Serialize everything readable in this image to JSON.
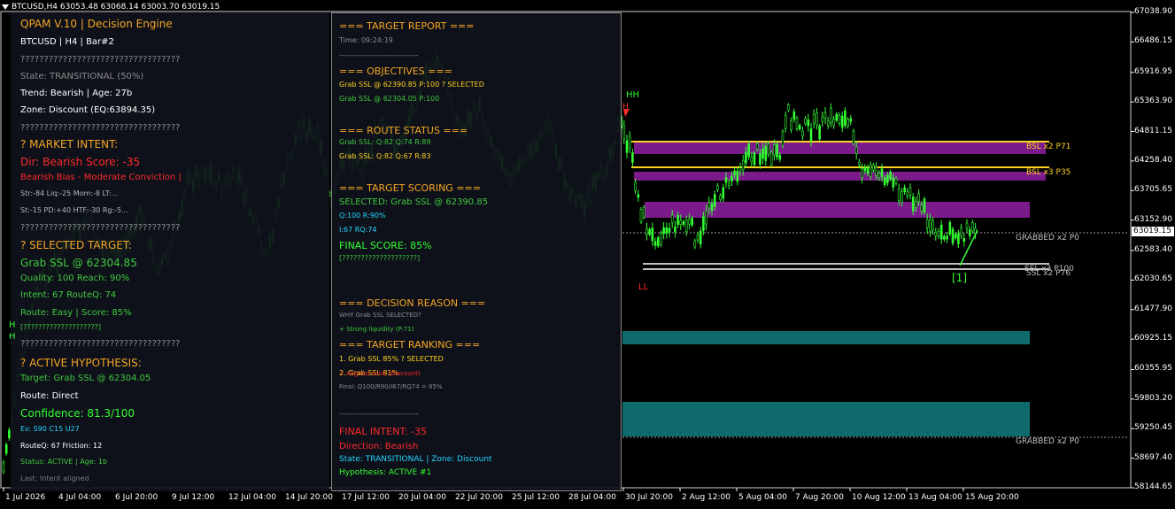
{
  "window": {
    "title": "BTCUSD,H4  63053.48 63068.14 63003.70 63019.15"
  },
  "chart_data": {
    "type": "candlestick",
    "symbol": "BTCUSD",
    "timeframe": "H4",
    "x_labels": [
      "1 Jul 2026",
      "4 Jul 04:00",
      "6 Jul 20:00",
      "9 Jul 12:00",
      "12 Jul 04:00",
      "14 Jul 20:00",
      "17 Jul 12:00",
      "20 Jul 04:00",
      "22 Jul 20:00",
      "25 Jul 12:00",
      "28 Jul 04:00",
      "30 Jul 20:00",
      "2 Aug 12:00",
      "5 Aug 04:00",
      "7 Aug 20:00",
      "10 Aug 12:00",
      "13 Aug 04:00",
      "15 Aug 20:00"
    ],
    "y_labels": [
      "67038.90",
      "66486.15",
      "65916.95",
      "65363.90",
      "64811.15",
      "64258.40",
      "63705.65",
      "63152.90",
      "62583.40",
      "62030.65",
      "61477.90",
      "60925.15",
      "60355.95",
      "59803.20",
      "59250.45",
      "58697.40",
      "58144.65"
    ],
    "current_price": "63019.15",
    "ylim": [
      58144.65,
      67038.9
    ],
    "zones": [
      {
        "label": "BSL x2 P71",
        "price": 64700,
        "color": "#ffd21e"
      },
      {
        "label": "BSL x3 P35",
        "price": 64160,
        "color": "#ffd21e"
      },
      {
        "label": "GRABBED x2 P0",
        "price": 62960,
        "color": "#bfbfbf"
      },
      {
        "label": "SSL x3 P100",
        "price": 62360,
        "color": "#bfbfbf"
      },
      {
        "label": "SSL x2 P76",
        "price": 62300,
        "color": "#bfbfbf"
      },
      {
        "label": "GRABBED x2 P0",
        "price": 59180,
        "color": "#bfbfbf"
      }
    ],
    "markers": [
      {
        "label": "HH",
        "color": "#33ff33"
      },
      {
        "label": "H",
        "color": "#ff2a2a"
      },
      {
        "label": "LL",
        "color": "#ff2a2a"
      },
      {
        "label": "[1]",
        "color": "#33ff33"
      },
      {
        "label": "H",
        "color": "#33ff33"
      },
      {
        "label": "H",
        "color": "#33ff33"
      }
    ],
    "colors": {
      "bull": "#33ff33",
      "bear": "#33ff33",
      "bsl": "#ffd21e",
      "purple": "#7b1a8a",
      "teal": "#0f6b6b"
    }
  },
  "left_panel": {
    "lines": [
      {
        "text": "QPAM V.10 | Decision Engine",
        "cls": "c-orange",
        "size": 12
      },
      {
        "text": "BTCUSD | H4 | Bar#2",
        "cls": "c-white",
        "size": 10
      },
      {
        "text": "??????????????????????????????????",
        "cls": "c-gray",
        "size": 10
      },
      {
        "text": "State: TRANSITIONAL (50%)",
        "cls": "c-gray",
        "size": 10
      },
      {
        "text": "Trend: Bearish | Age: 27b",
        "cls": "c-white",
        "size": 10
      },
      {
        "text": "Zone: Discount (EQ:63894.35)",
        "cls": "c-white",
        "size": 10
      },
      {
        "text": "??????????????????????????????????",
        "cls": "c-gray",
        "size": 10
      },
      {
        "text": "? MARKET INTENT:",
        "cls": "c-orange",
        "size": 12
      },
      {
        "text": "Dir: Bearish  Score: -35",
        "cls": "c-red",
        "size": 12
      },
      {
        "text": "Bearish Bias - Moderate Conviction |",
        "cls": "c-red",
        "size": 10
      },
      {
        "text": "Str:-84 Liq:-25 Mom:-8 LT:...",
        "cls": "c-lgray",
        "size": 8
      },
      {
        "text": "St:-15 PD:+40 HTF:-30 Rg:-5...",
        "cls": "c-lgray",
        "size": 8
      },
      {
        "text": "??????????????????????????????????",
        "cls": "c-gray",
        "size": 10
      },
      {
        "text": "? SELECTED TARGET:",
        "cls": "c-orange",
        "size": 12
      },
      {
        "text": "Grab SSL @ 62304.85",
        "cls": "c-green",
        "size": 12
      },
      {
        "text": "Quality: 100  Reach: 90%",
        "cls": "c-green",
        "size": 10
      },
      {
        "text": "Intent: 67  RouteQ: 74",
        "cls": "c-green",
        "size": 10
      },
      {
        "text": "Route: Easy | Score: 85%",
        "cls": "c-green",
        "size": 10
      },
      {
        "text": "[????????????????????]",
        "cls": "c-green",
        "size": 8
      },
      {
        "text": "??????????????????????????????????",
        "cls": "c-gray",
        "size": 10
      },
      {
        "text": "? ACTIVE HYPOTHESIS:",
        "cls": "c-orange",
        "size": 12
      },
      {
        "text": "Target: Grab SSL @ 62304.05",
        "cls": "c-green",
        "size": 10
      },
      {
        "text": "Route: Direct",
        "cls": "c-white",
        "size": 10
      },
      {
        "text": "Confidence: 81.3/100",
        "cls": "c-lime",
        "size": 12
      },
      {
        "text": "Ev: S90 C15 U27",
        "cls": "c-cyan",
        "size": 8
      },
      {
        "text": "RouteQ: 67 Friction: 12",
        "cls": "c-white",
        "size": 8
      },
      {
        "text": "Status: ACTIVE | Age: 1b",
        "cls": "c-green",
        "size": 8
      },
      {
        "text": "Last: Intent aligned",
        "cls": "c-dkgray",
        "size": 8
      }
    ]
  },
  "right_panel": {
    "lines": [
      {
        "text": "=== TARGET REPORT ===",
        "cls": "c-orange",
        "size": 11
      },
      {
        "text": "Time: 09:24:19",
        "cls": "c-gray",
        "size": 8
      },
      {
        "text": "-------------------------------",
        "cls": "c-gray",
        "size": 8
      },
      {
        "text": "=== OBJECTIVES ===",
        "cls": "c-orange",
        "size": 11
      },
      {
        "text": "Grab SSL @ 62390.85 P:100 ? SELECTED",
        "cls": "c-yellow",
        "size": 8
      },
      {
        "text": "Grab SSL @ 62304.05 P:100",
        "cls": "c-green",
        "size": 8
      },
      {
        "text": "=== ROUTE STATUS ===",
        "cls": "c-orange",
        "size": 11
      },
      {
        "text": "Grab SSL: Q:82 Q:74 R:89",
        "cls": "c-green",
        "size": 8
      },
      {
        "text": "Grab SSL: Q:82 Q:67 R:83",
        "cls": "c-yellow",
        "size": 8
      },
      {
        "text": "=== TARGET SCORING ===",
        "cls": "c-orange",
        "size": 11
      },
      {
        "text": "SELECTED: Grab SSL @ 62390.85",
        "cls": "c-green",
        "size": 10
      },
      {
        "text": "Q:100 R:90%",
        "cls": "c-cyan",
        "size": 8
      },
      {
        "text": "I:67 RQ:74",
        "cls": "c-cyan",
        "size": 8
      },
      {
        "text": "FINAL SCORE: 85%",
        "cls": "c-lime",
        "size": 11
      },
      {
        "text": "[????????????????????]",
        "cls": "c-green",
        "size": 8
      },
      {
        "text": "=== DECISION REASON ===",
        "cls": "c-orange",
        "size": 11
      },
      {
        "text": "WHY Grab SSL SELECTED?",
        "cls": "c-gray",
        "size": 7
      },
      {
        "text": "+ Strong liquidity (P:71)",
        "cls": "c-green",
        "size": 7
      },
      {
        "text": "=== TARGET RANKING ===",
        "cls": "c-orange",
        "size": 11
      },
      {
        "text": "1. Grab SSL 85% ? SELECTED",
        "cls": "c-yellow",
        "size": 8
      },
      {
        "text": "2. Grab SSL 81%",
        "cls": "c-yellow",
        "size": 8
      },
      {
        "text": "+ Aligned zone (Discount)",
        "cls": "c-red",
        "size": 7
      },
      {
        "text": "Final: Q100/R90/I67/RQ74 = 85%",
        "cls": "c-gray",
        "size": 7
      },
      {
        "text": "-------------------------------",
        "cls": "c-gray",
        "size": 8
      },
      {
        "text": "FINAL INTENT: -35",
        "cls": "c-red",
        "size": 11
      },
      {
        "text": "Direction: Bearish",
        "cls": "c-red",
        "size": 10
      },
      {
        "text": "State: TRANSITIONAL | Zone: Discount",
        "cls": "c-cyan",
        "size": 9
      },
      {
        "text": "Hypothesis: ACTIVE #1",
        "cls": "c-lime",
        "size": 9
      }
    ]
  }
}
